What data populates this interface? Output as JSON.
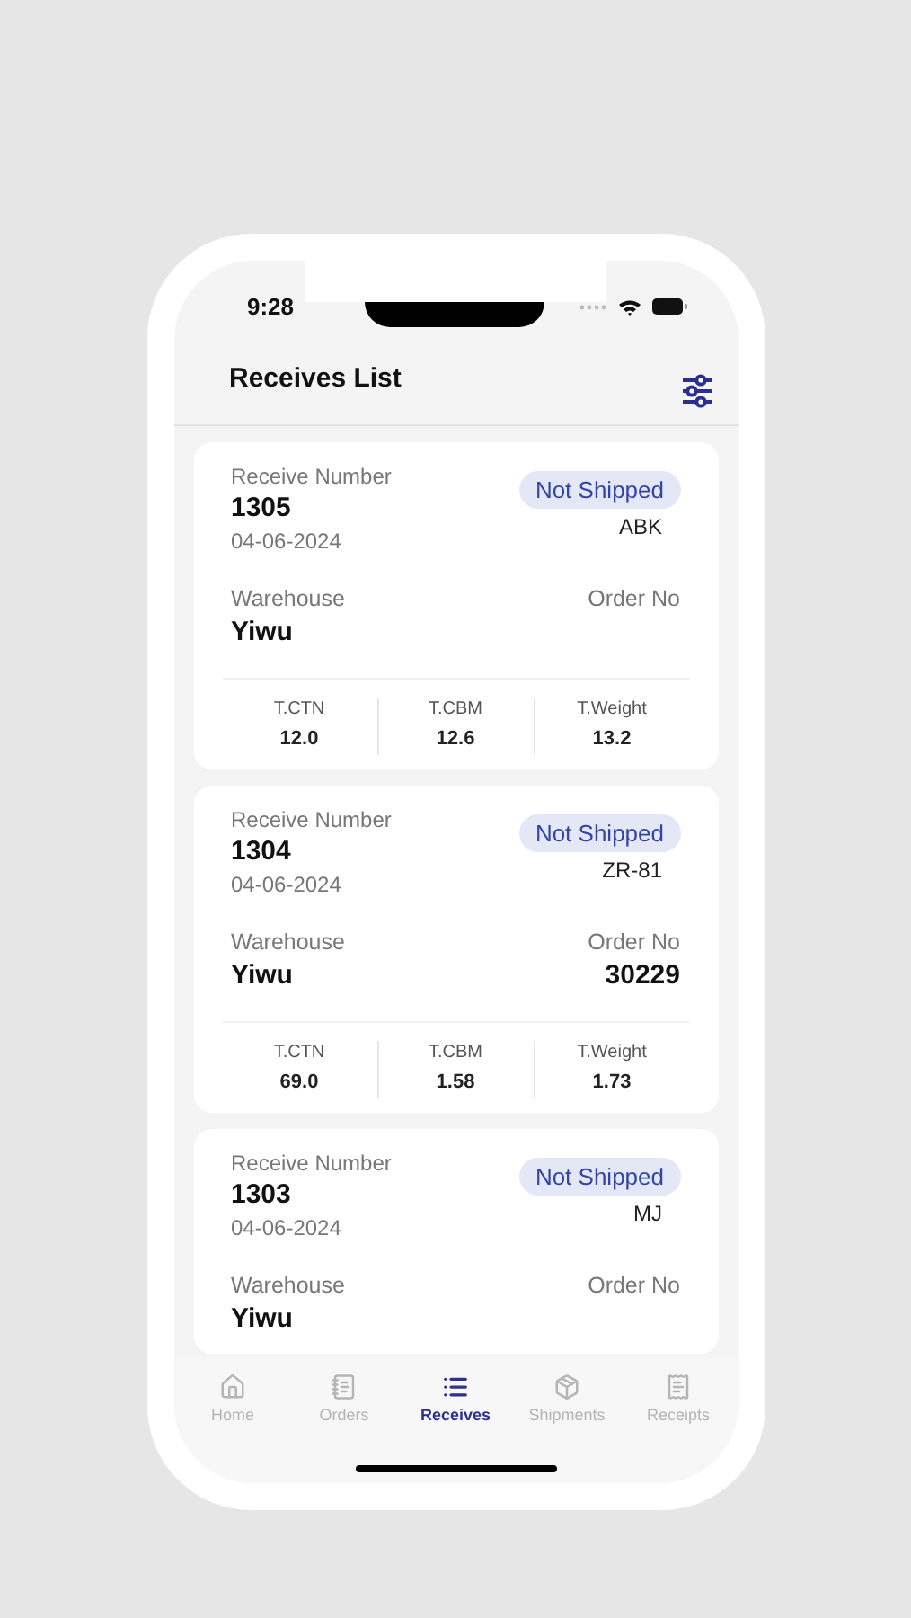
{
  "status_bar": {
    "time": "9:28"
  },
  "header": {
    "title": "Receives List"
  },
  "receives": [
    {
      "label": "Receive Number",
      "number": "1305",
      "date": "04-06-2024",
      "status": "Not Shipped",
      "code": "ABK",
      "warehouse_label": "Warehouse",
      "warehouse": "Yiwu",
      "order_label": "Order No",
      "stats": [
        {
          "label": "T.CTN",
          "value": "12.0"
        },
        {
          "label": "T.CBM",
          "value": "12.6"
        },
        {
          "label": "T.Weight",
          "value": "13.2"
        }
      ]
    },
    {
      "label": "Receive Number",
      "number": "1304",
      "date": "04-06-2024",
      "status": "Not Shipped",
      "code": "ZR-81",
      "warehouse_label": "Warehouse",
      "warehouse": "Yiwu",
      "order_label": "Order No",
      "order_no": "30229",
      "stats": [
        {
          "label": "T.CTN",
          "value": "69.0"
        },
        {
          "label": "T.CBM",
          "value": "1.58"
        },
        {
          "label": "T.Weight",
          "value": "1.73"
        }
      ]
    },
    {
      "label": "Receive Number",
      "number": "1303",
      "date": "04-06-2024",
      "status": "Not Shipped",
      "code": "MJ",
      "warehouse_label": "Warehouse",
      "warehouse": "Yiwu",
      "order_label": "Order No"
    }
  ],
  "tabs": [
    {
      "kind": "home",
      "label": "Home",
      "selected": false
    },
    {
      "kind": "orders",
      "label": "Orders",
      "selected": false
    },
    {
      "kind": "receives",
      "label": "Receives",
      "selected": true
    },
    {
      "kind": "shipments",
      "label": "Shipments",
      "selected": false
    },
    {
      "kind": "receipts",
      "label": "Receipts",
      "selected": false
    }
  ]
}
